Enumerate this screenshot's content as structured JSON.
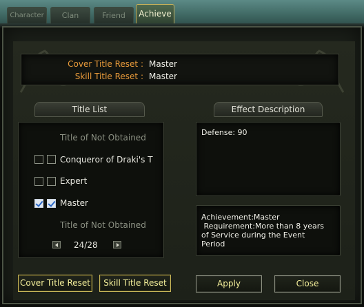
{
  "tabs": [
    {
      "label": "Character"
    },
    {
      "label": "Clan"
    },
    {
      "label": "Friend"
    },
    {
      "label": "Achieve"
    }
  ],
  "header": {
    "cover_title_reset_label": "Cover Title Reset :",
    "cover_title_reset_value": "Master",
    "skill_title_reset_label": "Skill Title Reset :",
    "skill_title_reset_value": "Master"
  },
  "title_list": {
    "heading": "Title List",
    "items": [
      {
        "text": "Title of Not Obtained"
      },
      {
        "text": "Conqueror of Draki's T",
        "cover_checked": false,
        "skill_checked": false
      },
      {
        "text": "Expert",
        "cover_checked": false,
        "skill_checked": false
      },
      {
        "text": "Master",
        "cover_checked": true,
        "skill_checked": true
      },
      {
        "text": "Title of Not Obtained"
      }
    ],
    "page": "24/28"
  },
  "effect": {
    "heading": "Effect Description",
    "description": "Defense: 90",
    "achievement_lines": [
      "Achievement:Master",
      " Requirement:More than 8 years",
      "of Service during the Event",
      "Period"
    ]
  },
  "buttons": {
    "cover_title_reset": "Cover Title Reset",
    "skill_title_reset": "Skill Title Reset",
    "apply": "Apply",
    "close": "Close"
  },
  "colors": {
    "accent_label": "#e89a3a",
    "button_text": "#f4ef9a",
    "button_border": "#c8b658",
    "checkbox_check": "#2a68c8"
  }
}
